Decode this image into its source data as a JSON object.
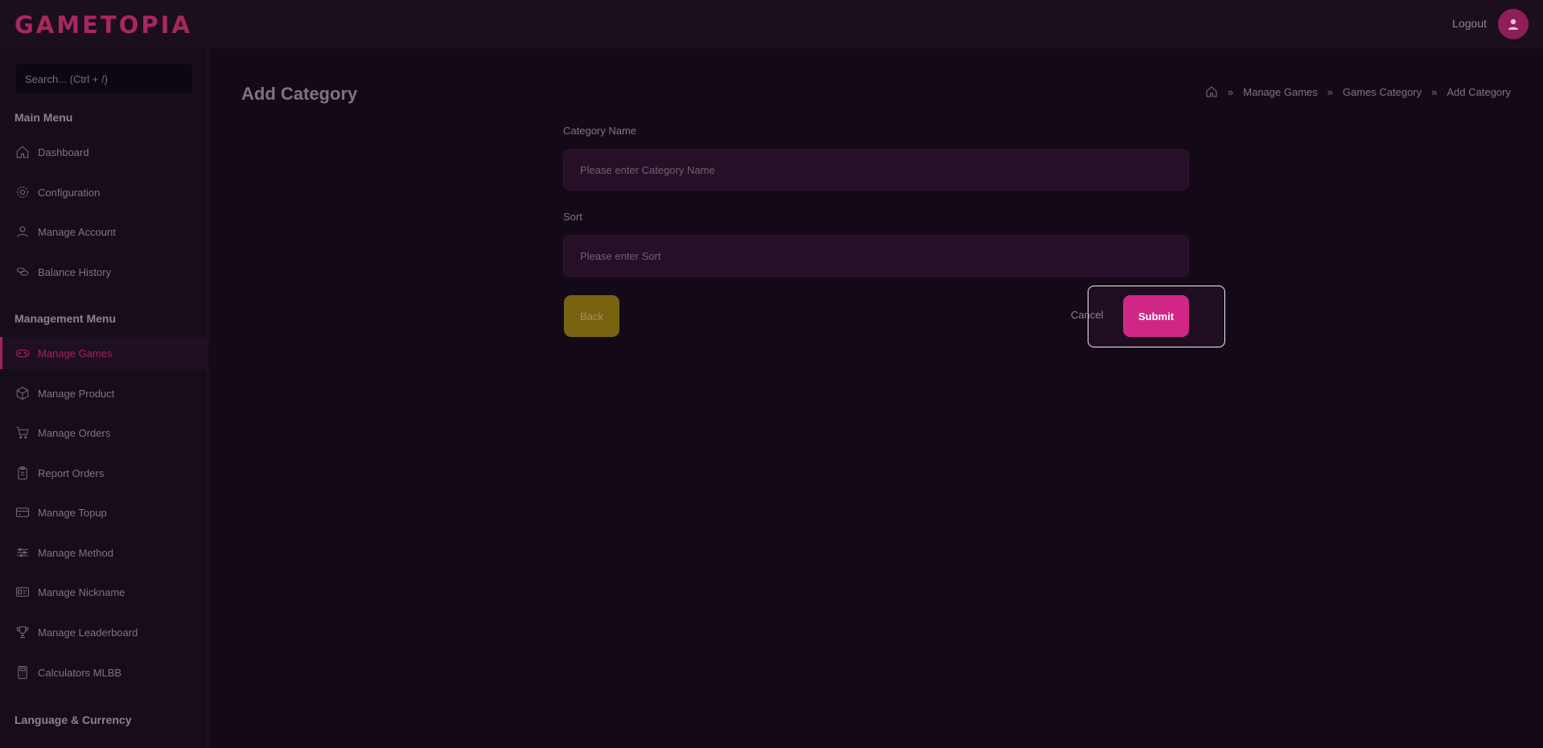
{
  "app": {
    "brand": "GAMETOPIA"
  },
  "header": {
    "logout_label": "Logout"
  },
  "sidebar": {
    "search_placeholder": "Search... (Ctrl + /)",
    "main_menu_title": "Main Menu",
    "main_items": [
      {
        "label": "Dashboard",
        "icon": "home-icon"
      },
      {
        "label": "Configuration",
        "icon": "gear-icon"
      },
      {
        "label": "Manage Account",
        "icon": "user-icon"
      },
      {
        "label": "Balance History",
        "icon": "coins-icon"
      }
    ],
    "management_menu_title": "Management Menu",
    "management_items": [
      {
        "label": "Manage Games",
        "icon": "gamepad-icon",
        "active": true
      },
      {
        "label": "Manage Product",
        "icon": "box-icon"
      },
      {
        "label": "Manage Orders",
        "icon": "cart-icon"
      },
      {
        "label": "Report Orders",
        "icon": "clipboard-icon"
      },
      {
        "label": "Manage Topup",
        "icon": "card-icon"
      },
      {
        "label": "Manage Method",
        "icon": "sliders-icon"
      },
      {
        "label": "Manage Nickname",
        "icon": "id-card-icon"
      },
      {
        "label": "Manage Leaderboard",
        "icon": "trophy-icon"
      },
      {
        "label": "Calculators MLBB",
        "icon": "calculator-icon"
      }
    ],
    "language_title": "Language & Currency"
  },
  "main": {
    "page_title": "Add Category",
    "breadcrumb": [
      "Manage Games",
      "Games Category",
      "Add Category"
    ],
    "form": {
      "category_name_label": "Category Name",
      "category_name_placeholder": "Please enter Category Name",
      "category_name_value": "",
      "sort_label": "Sort",
      "sort_placeholder": "Please enter Sort",
      "sort_value": ""
    },
    "buttons": {
      "back": "Back",
      "cancel": "Cancel",
      "submit": "Submit"
    }
  },
  "colors": {
    "background": "#140a17",
    "accent": "#d02787",
    "active_nav": "#a4245c",
    "back_button": "#7a6310"
  }
}
